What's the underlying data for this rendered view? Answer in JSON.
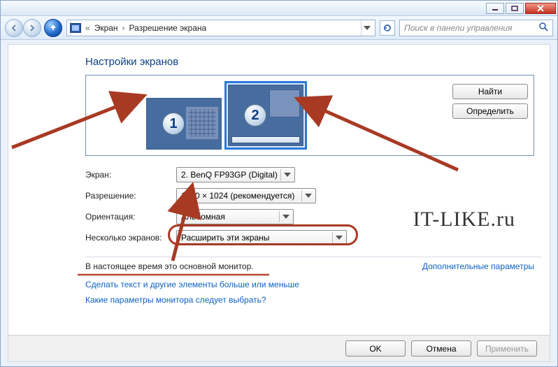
{
  "breadcrumb": {
    "item1": "Экран",
    "item2": "Разрешение экрана"
  },
  "search": {
    "placeholder": "Поиск в панели управления"
  },
  "heading": "Настройки экранов",
  "monitors": {
    "badge1": "1",
    "badge2": "2"
  },
  "buttons": {
    "find": "Найти",
    "detect": "Определить"
  },
  "labels": {
    "screen": "Экран:",
    "resolution": "Разрешение:",
    "orientation": "Ориентация:",
    "multi": "Несколько экранов:"
  },
  "values": {
    "screen": "2. BenQ FP93GP (Digital)",
    "resolution": "1280 × 1024 (рекомендуется)",
    "orientation": "Альбомная",
    "multi": "Расширить эти экраны"
  },
  "note": "В настоящее время это основной монитор.",
  "advanced": "Дополнительные параметры",
  "links": {
    "a": "Сделать текст и другие элементы больше или меньше",
    "b": "Какие параметры монитора следует выбрать?"
  },
  "footer": {
    "ok": "OK",
    "cancel": "Отмена",
    "apply": "Применить"
  },
  "watermark": "IT-LIKE.ru"
}
